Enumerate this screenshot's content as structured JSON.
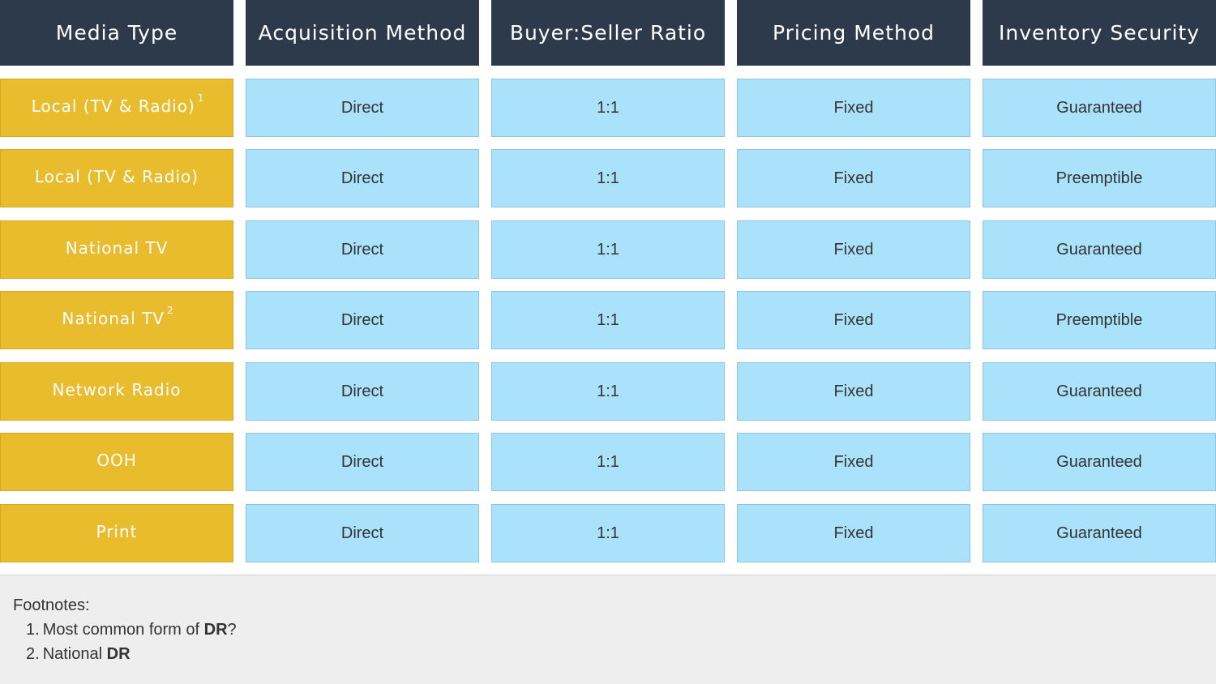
{
  "headers": [
    "Media Type",
    "Acquisition Method",
    "Buyer:Seller Ratio",
    "Pricing Method",
    "Inventory Security"
  ],
  "rows": [
    {
      "media": "Local (TV & Radio)",
      "sup": "1",
      "acquisition": "Direct",
      "ratio": "1:1",
      "pricing": "Fixed",
      "security": "Guaranteed"
    },
    {
      "media": "Local (TV & Radio)",
      "sup": "",
      "acquisition": "Direct",
      "ratio": "1:1",
      "pricing": "Fixed",
      "security": "Preemptible"
    },
    {
      "media": "National TV",
      "sup": "",
      "acquisition": "Direct",
      "ratio": "1:1",
      "pricing": "Fixed",
      "security": "Guaranteed"
    },
    {
      "media": "National TV",
      "sup": "2",
      "acquisition": "Direct",
      "ratio": "1:1",
      "pricing": "Fixed",
      "security": "Preemptible"
    },
    {
      "media": "Network Radio",
      "sup": "",
      "acquisition": "Direct",
      "ratio": "1:1",
      "pricing": "Fixed",
      "security": "Guaranteed"
    },
    {
      "media": "OOH",
      "sup": "",
      "acquisition": "Direct",
      "ratio": "1:1",
      "pricing": "Fixed",
      "security": "Guaranteed"
    },
    {
      "media": "Print",
      "sup": "",
      "acquisition": "Direct",
      "ratio": "1:1",
      "pricing": "Fixed",
      "security": "Guaranteed"
    }
  ],
  "footnotes": {
    "title": "Footnotes:",
    "items": [
      {
        "number": "1.",
        "text": "Most common form of ",
        "bold": "DR",
        "suffix": "?"
      },
      {
        "number": "2.",
        "text": "National ",
        "bold": "DR",
        "suffix": ""
      }
    ]
  },
  "colors": {
    "header": "#2c3a4b",
    "media_cell": "#e8bc2d",
    "value_cell": "#aae2fb",
    "footer": "#eeeeee"
  }
}
